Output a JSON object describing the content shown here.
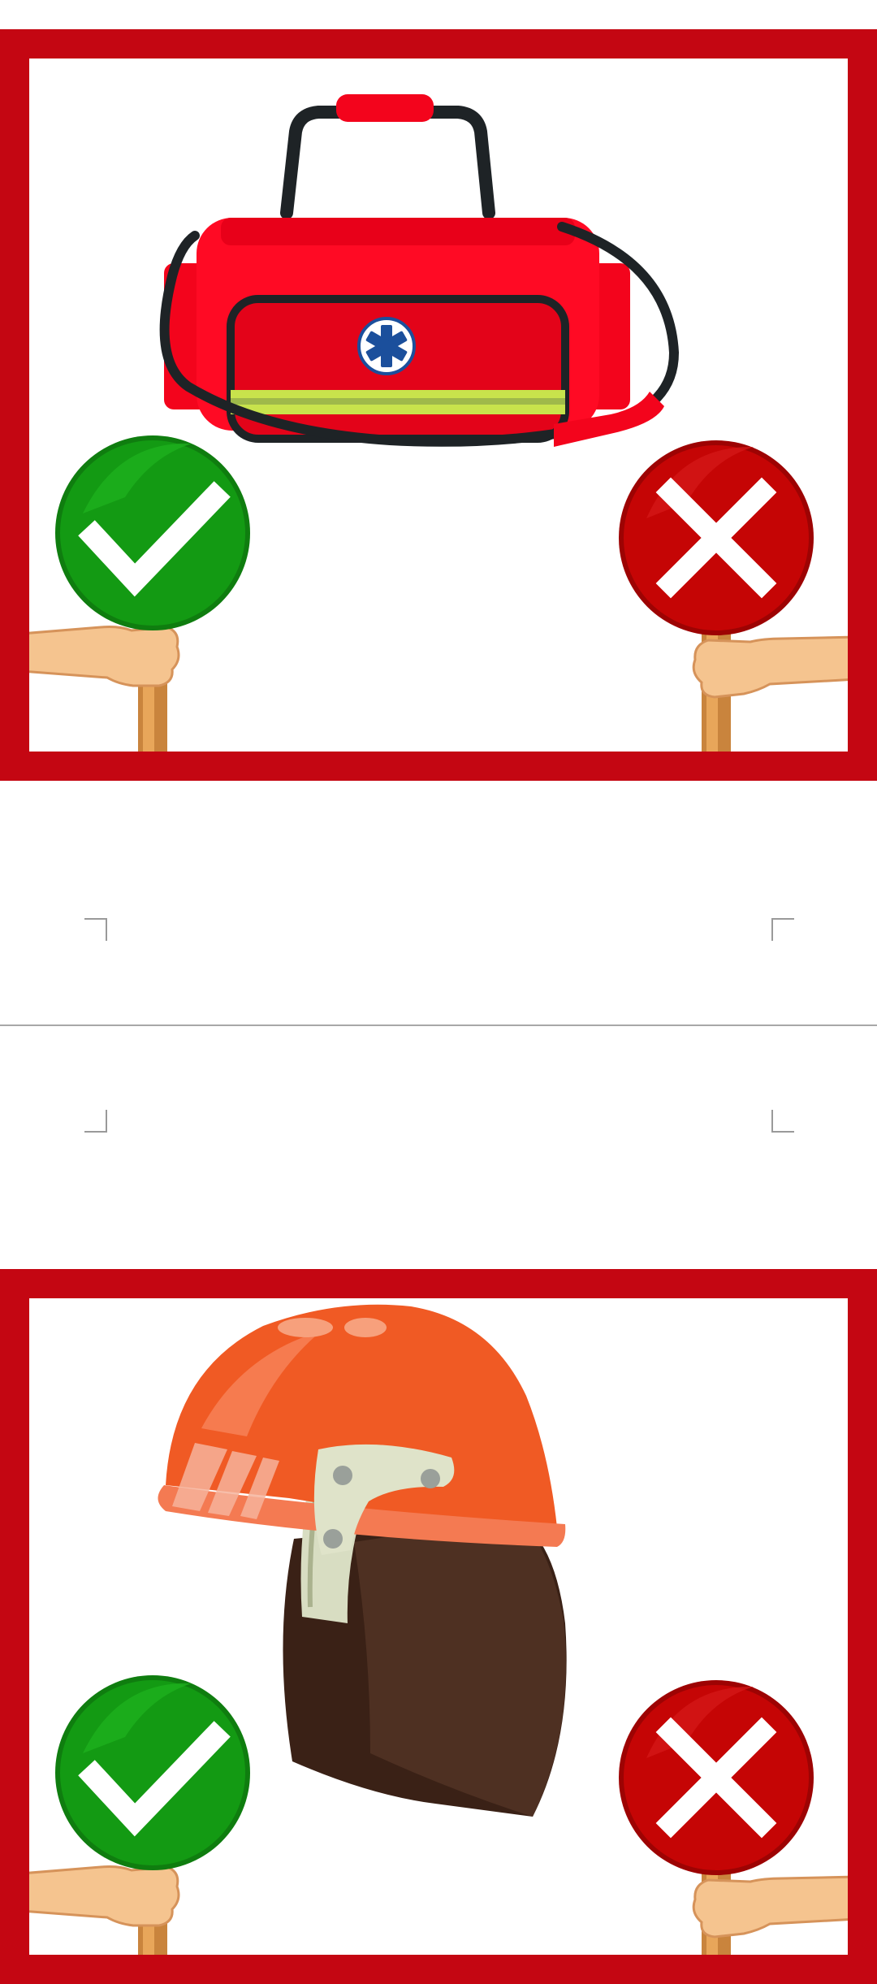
{
  "cards": [
    {
      "subject": "medical-bag",
      "yes_sign": "check-mark",
      "no_sign": "x-mark"
    },
    {
      "subject": "firefighter-helmet",
      "yes_sign": "check-mark",
      "no_sign": "x-mark"
    }
  ],
  "colors": {
    "frame": "#c40612",
    "yes_sign": "#139a13",
    "no_sign": "#c50505",
    "bag_red": "#f3041c",
    "helmet_orange": "#f05a24",
    "neck_curtain": "#4a2c1f"
  }
}
